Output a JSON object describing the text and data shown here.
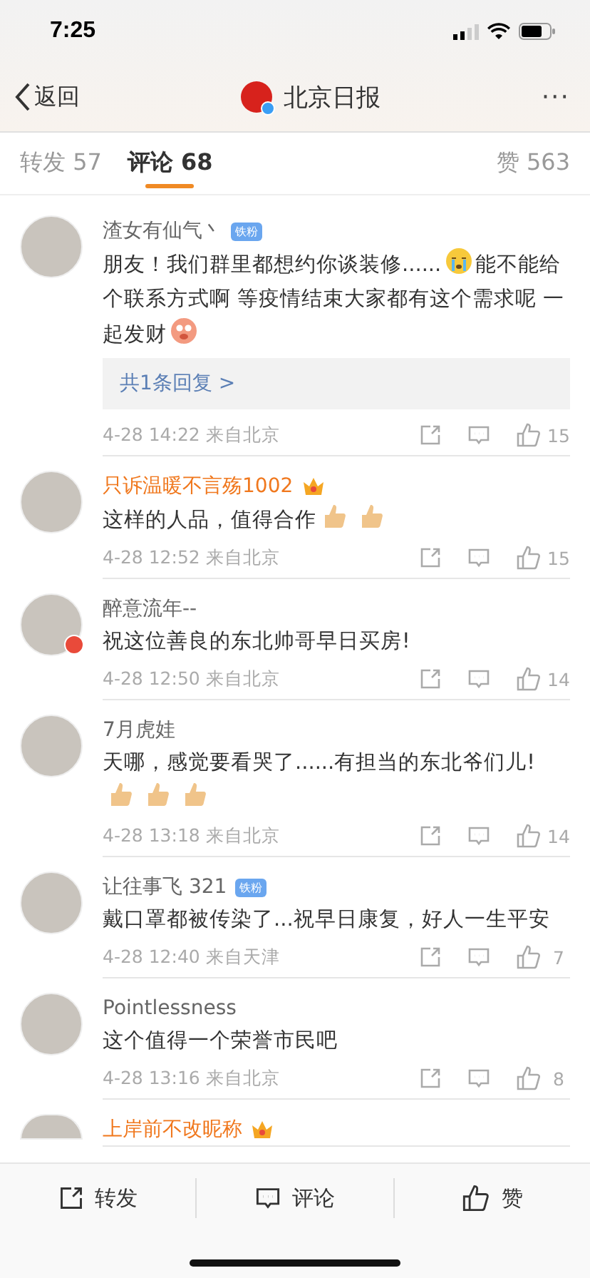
{
  "status_bar": {
    "time": "7:25"
  },
  "nav": {
    "back": "返回",
    "title": "北京日报",
    "more": "···"
  },
  "tabs": [
    {
      "label": "转发 57",
      "selected": false
    },
    {
      "label": "评论 68",
      "selected": true
    },
    {
      "label": "赞 563",
      "selected": false
    }
  ],
  "comments": [
    {
      "name": "渣女有仙气丶",
      "vip": false,
      "fan_badge": "铁粉",
      "verified": false,
      "segments": [
        {
          "kind": "text",
          "text": "朋友！我们群里都想约你谈装修......"
        },
        {
          "kind": "cry"
        },
        {
          "kind": "text",
          "text": "能不能给"
        },
        {
          "kind": "text",
          "text": "个联系方式啊 等疫情结束大家都有这个需求呢 一"
        },
        {
          "kind": "text",
          "text": "起发财"
        },
        {
          "kind": "pig"
        }
      ],
      "replies": "共1条回复 >",
      "time": "4-28 14:22",
      "source": "来自北京",
      "likes": "15"
    },
    {
      "name": "只诉温暖不言殇1002",
      "vip": true,
      "verified": false,
      "segments": [
        {
          "kind": "text",
          "text": "这样的人品，值得合作"
        },
        {
          "kind": "thumb"
        },
        {
          "kind": "thumb"
        }
      ],
      "time": "4-28 12:52",
      "source": "来自北京",
      "likes": "15"
    },
    {
      "name": "醉意流年--",
      "vip": false,
      "verified": true,
      "segments": [
        {
          "kind": "text",
          "text": "祝这位善良的东北帅哥早日买房!"
        }
      ],
      "time": "4-28 12:50",
      "source": "来自北京",
      "likes": "14"
    },
    {
      "name": "7月虎娃",
      "vip": false,
      "verified": false,
      "segments": [
        {
          "kind": "text",
          "text": "天哪，感觉要看哭了......有担当的东北爷们儿!"
        },
        {
          "kind": "break"
        },
        {
          "kind": "thumb"
        },
        {
          "kind": "thumb"
        },
        {
          "kind": "thumb"
        }
      ],
      "time": "4-28 13:18",
      "source": "来自北京",
      "likes": "14"
    },
    {
      "name": "让往事飞 321",
      "vip": false,
      "fan_badge": "铁粉",
      "verified": false,
      "segments": [
        {
          "kind": "text",
          "text": "戴口罩都被传染了...祝早日康复，好人一生平安"
        }
      ],
      "time": "4-28 12:40",
      "source": "来自天津",
      "likes": "7"
    },
    {
      "name": "Pointlessness",
      "vip": false,
      "verified": false,
      "segments": [
        {
          "kind": "text",
          "text": "这个值得一个荣誉市民吧"
        }
      ],
      "time": "4-28 13:16",
      "source": "来自北京",
      "likes": "8"
    },
    {
      "name": "上岸前不改昵称",
      "vip": true,
      "verified": false
    }
  ],
  "bottom_bar": [
    {
      "label": "转发",
      "kind": "repost"
    },
    {
      "label": "评论",
      "kind": "comment"
    },
    {
      "label": "赞",
      "kind": "like"
    }
  ]
}
